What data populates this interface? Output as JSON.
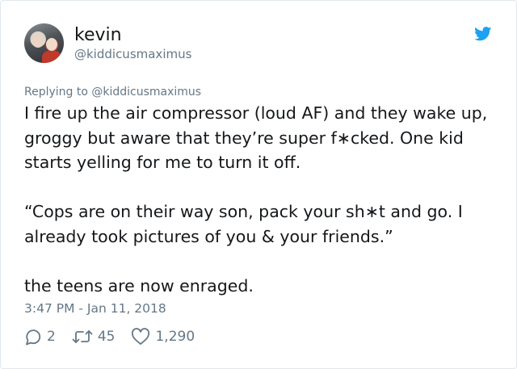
{
  "author": {
    "display_name": "kevin",
    "handle": "@kiddicusmaximus"
  },
  "reply_line": "Replying to @kiddicusmaximus",
  "paragraphs": [
    "I fire up the air compressor (loud AF) and they wake up, groggy but aware that they’re super f∗cked. One kid starts yelling for me to turn it off.",
    "“Cops are on their way son, pack your sh∗t and go. I already took pictures of you & your friends.”",
    "the teens are now enraged."
  ],
  "timestamp": "3:47 PM - Jan 11, 2018",
  "stats": {
    "replies": "2",
    "retweets": "45",
    "likes": "1,290"
  },
  "icons": {
    "brand": "twitter-bird-icon",
    "reply": "reply-icon",
    "retweet": "retweet-icon",
    "like": "heart-icon"
  },
  "colors": {
    "brand": "#1da1f2",
    "text": "#14171a",
    "secondary": "#657786",
    "border": "#e1e8ed"
  }
}
